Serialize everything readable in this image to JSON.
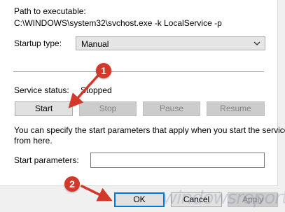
{
  "path": {
    "label": "Path to executable:",
    "value": "C:\\WINDOWS\\system32\\svchost.exe -k LocalService -p"
  },
  "startup_type": {
    "label": "Startup type:",
    "selected": "Manual"
  },
  "service_status": {
    "label": "Service status:",
    "value": "Stopped"
  },
  "service_buttons": {
    "start": "Start",
    "stop": "Stop",
    "pause": "Pause",
    "resume": "Resume"
  },
  "start_params": {
    "description_line1": "You can specify the start parameters that apply when you start the service",
    "description_line2": "from here.",
    "label": "Start parameters:",
    "value": ""
  },
  "dialog_buttons": {
    "ok": "OK",
    "cancel": "Cancel",
    "apply": "Apply"
  },
  "callouts": {
    "one": "1",
    "two": "2"
  },
  "watermark": "windowsreport",
  "colors": {
    "callout": "#d2392b",
    "focus_border": "#0078d7"
  }
}
